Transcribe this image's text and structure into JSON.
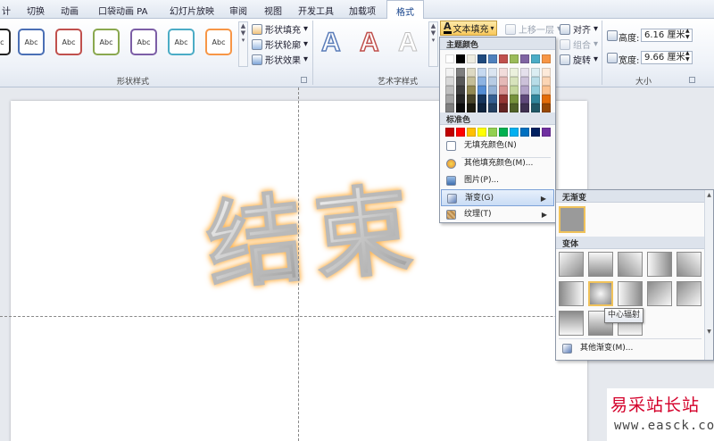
{
  "tabs": [
    {
      "label": "计",
      "active": false
    },
    {
      "label": "切换",
      "active": false
    },
    {
      "label": "动画",
      "active": false
    },
    {
      "label": "口袋动画 PA",
      "active": false
    },
    {
      "label": "幻灯片放映",
      "active": false
    },
    {
      "label": "审阅",
      "active": false
    },
    {
      "label": "视图",
      "active": false
    },
    {
      "label": "开发工具",
      "active": false
    },
    {
      "label": "加载项",
      "active": false
    },
    {
      "label": "格式",
      "active": true
    }
  ],
  "shape_styles": {
    "group_label": "形状样式",
    "sample_text": "Abc",
    "box_colors": [
      "#222222",
      "#4a6fb5",
      "#c0504d",
      "#8aa84f",
      "#7c5ea6",
      "#4bacc6",
      "#f79646"
    ],
    "commands": [
      "形状填充",
      "形状轮廓",
      "形状效果"
    ]
  },
  "wordart": {
    "group_label": "艺术字样式",
    "letter": "A",
    "text_fill_label": "文本填充"
  },
  "arrange": {
    "bring_forward": "上移一层",
    "align": "对齐",
    "group": "组合",
    "rotate": "旋转"
  },
  "size": {
    "group_label": "大小",
    "height_label": "高度:",
    "height_value": "6.16 厘米",
    "width_label": "宽度:",
    "width_value": "9.66 厘米"
  },
  "slide": {
    "char1": "结",
    "char2": "束"
  },
  "color_menu": {
    "theme_colors_label": "主题颜色",
    "standard_colors_label": "标准色",
    "theme_top_row": [
      "#ffffff",
      "#000000",
      "#eeece1",
      "#1f497d",
      "#4f81bd",
      "#c0504d",
      "#9bbb59",
      "#8064a2",
      "#4bacc6",
      "#f79646"
    ],
    "theme_shades": [
      [
        "#f2f2f2",
        "#7f7f7f",
        "#ddd9c3",
        "#c6d9f0",
        "#dbe5f1",
        "#f2dcdb",
        "#ebf1dd",
        "#e5e0ec",
        "#dbeef3",
        "#fdeada"
      ],
      [
        "#d8d8d8",
        "#595959",
        "#c4bd97",
        "#8db3e2",
        "#b8cce4",
        "#e5b9b7",
        "#d7e3bc",
        "#ccc1d9",
        "#b7dde8",
        "#fbd5b5"
      ],
      [
        "#bfbfbf",
        "#3f3f3f",
        "#938953",
        "#548dd4",
        "#95b3d7",
        "#d99694",
        "#c3d69b",
        "#b2a2c7",
        "#92cddc",
        "#fac08f"
      ],
      [
        "#a5a5a5",
        "#262626",
        "#494429",
        "#17365d",
        "#366092",
        "#953734",
        "#76923c",
        "#5f497a",
        "#31859b",
        "#e36c09"
      ],
      [
        "#7f7f7f",
        "#0c0c0c",
        "#1d1b10",
        "#0f243e",
        "#244061",
        "#632423",
        "#4f6128",
        "#3f3151",
        "#205867",
        "#974806"
      ]
    ],
    "standard": [
      "#c00000",
      "#ff0000",
      "#ffc000",
      "#ffff00",
      "#92d050",
      "#00b050",
      "#00b0f0",
      "#0070c0",
      "#002060",
      "#7030a0"
    ],
    "items": {
      "no_fill": "无填充颜色(N)",
      "more_colors": "其他填充颜色(M)...",
      "picture": "图片(P)...",
      "gradient": "渐变(G)",
      "texture": "纹理(T)"
    }
  },
  "gradient_menu": {
    "none_label": "无渐变",
    "variants_label": "变体",
    "more": "其他渐变(M)...",
    "tooltip": "中心辐射"
  },
  "watermark": {
    "title": "易采站长站",
    "url": "www.easck.com"
  }
}
